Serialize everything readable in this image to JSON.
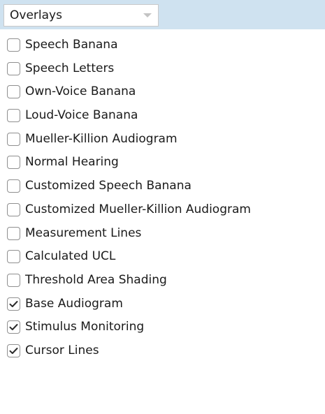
{
  "dropdown": {
    "selected": "Overlays",
    "icon": "chevron-down-icon"
  },
  "overlays": [
    {
      "label": "Speech Banana",
      "checked": false
    },
    {
      "label": "Speech Letters",
      "checked": false
    },
    {
      "label": "Own-Voice Banana",
      "checked": false
    },
    {
      "label": "Loud-Voice Banana",
      "checked": false
    },
    {
      "label": "Mueller-Killion Audiogram",
      "checked": false
    },
    {
      "label": "Normal Hearing",
      "checked": false
    },
    {
      "label": "Customized Speech Banana",
      "checked": false
    },
    {
      "label": "Customized Mueller-Killion Audiogram",
      "checked": false
    },
    {
      "label": "Measurement Lines",
      "checked": false
    },
    {
      "label": "Calculated UCL",
      "checked": false
    },
    {
      "label": "Threshold Area Shading",
      "checked": false
    },
    {
      "label": "Base Audiogram",
      "checked": true
    },
    {
      "label": "Stimulus Monitoring",
      "checked": true
    },
    {
      "label": "Cursor Lines",
      "checked": true
    }
  ],
  "colors": {
    "header_background": "#cfe2f0",
    "checkbox_border": "#8f8f8f",
    "checkmark": "#2b2b2b",
    "text": "#1a1a1a"
  }
}
